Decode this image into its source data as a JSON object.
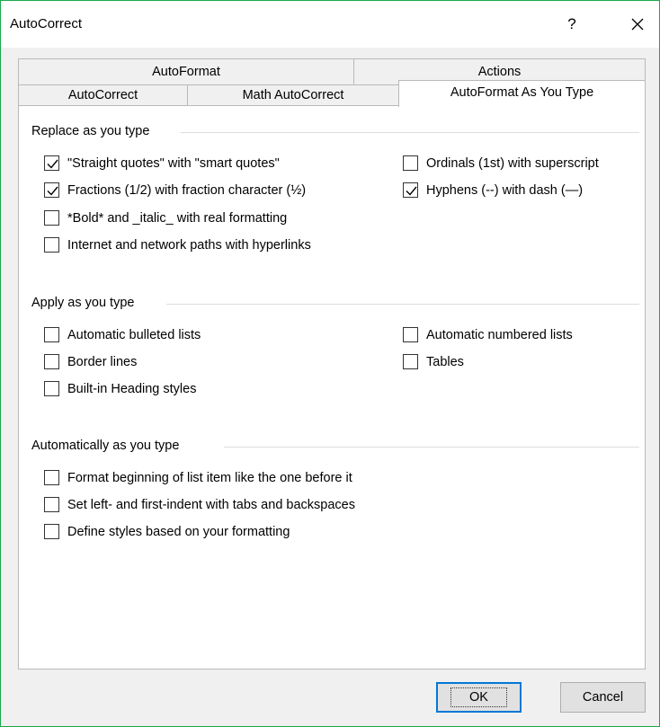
{
  "window": {
    "title": "AutoCorrect",
    "help_glyph": "?",
    "close_icon": "close-icon"
  },
  "tabs": {
    "row1": [
      {
        "label": "AutoFormat"
      },
      {
        "label": "Actions"
      }
    ],
    "row2": [
      {
        "label": "AutoCorrect"
      },
      {
        "label": "Math AutoCorrect"
      },
      {
        "label": "AutoFormat As You Type",
        "active": true
      }
    ]
  },
  "sections": {
    "replace": {
      "title": "Replace as you type",
      "options": [
        {
          "label": "\"Straight quotes\" with \"smart quotes\"",
          "checked": true
        },
        {
          "label": "Fractions (1/2) with fraction character (½)",
          "checked": true
        },
        {
          "label": "*Bold* and _italic_ with real formatting",
          "checked": false
        },
        {
          "label": "Internet and network paths with hyperlinks",
          "checked": false
        },
        {
          "label": "Ordinals (1st) with superscript",
          "checked": false
        },
        {
          "label": "Hyphens (--) with dash (—)",
          "checked": true
        }
      ]
    },
    "apply": {
      "title": "Apply as you type",
      "options": [
        {
          "label": "Automatic bulleted lists",
          "checked": false
        },
        {
          "label": "Border lines",
          "checked": false
        },
        {
          "label": "Built-in Heading styles",
          "checked": false
        },
        {
          "label": "Automatic numbered lists",
          "checked": false
        },
        {
          "label": "Tables",
          "checked": false
        }
      ]
    },
    "auto": {
      "title": "Automatically as you type",
      "options": [
        {
          "label": "Format beginning of list item like the one before it",
          "checked": false
        },
        {
          "label": "Set left- and first-indent with tabs and backspaces",
          "checked": false
        },
        {
          "label": "Define styles based on your formatting",
          "checked": false
        }
      ]
    }
  },
  "buttons": {
    "ok": "OK",
    "cancel": "Cancel"
  },
  "colors": {
    "frame_accent": "#1aa84a",
    "default_button_border": "#0078d7"
  }
}
